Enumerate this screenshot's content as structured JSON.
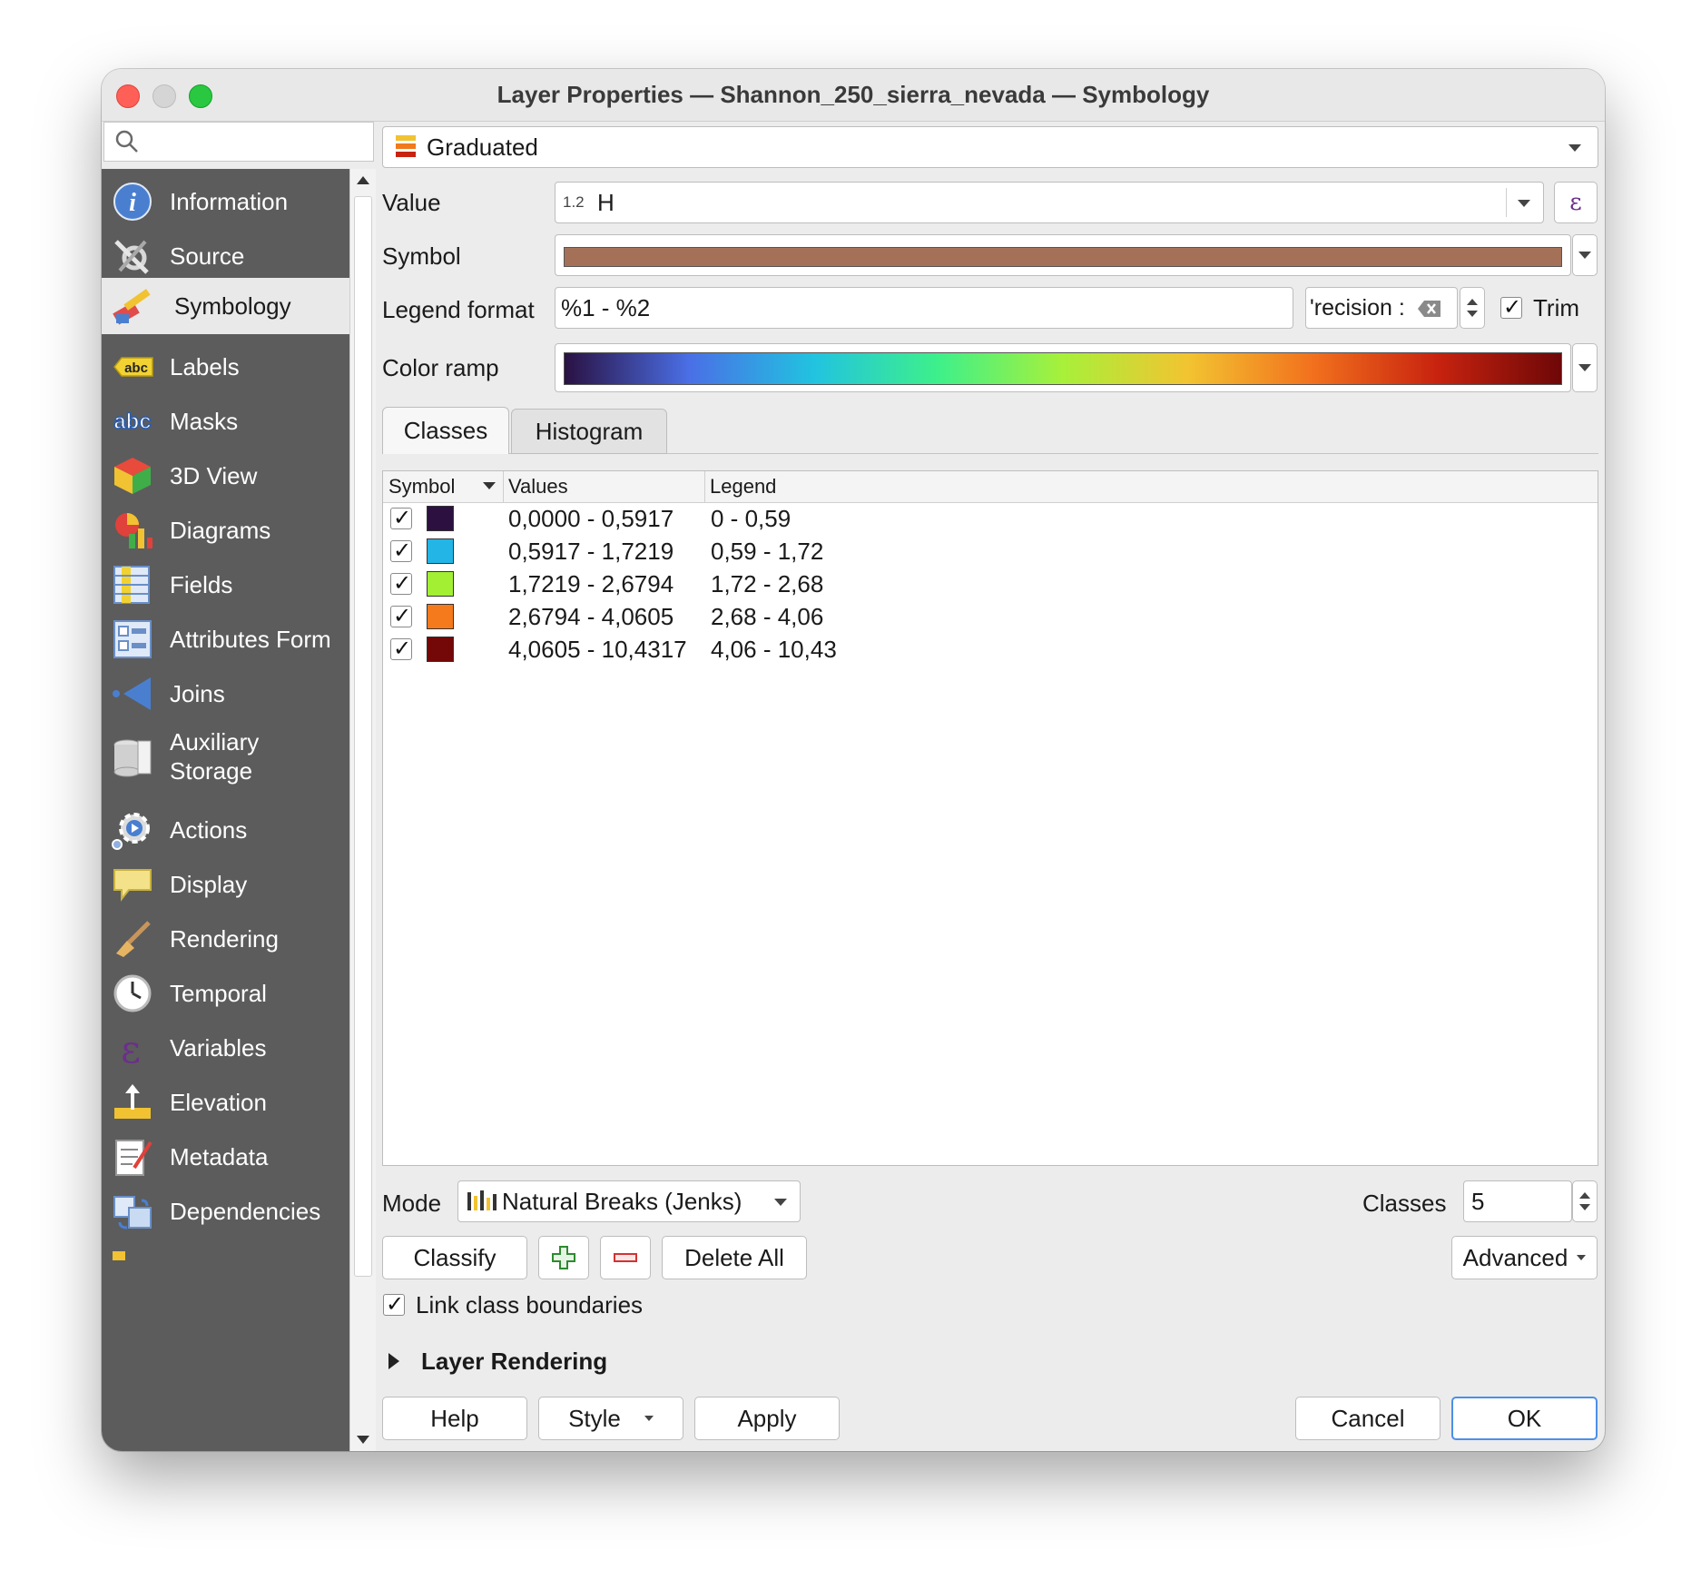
{
  "window": {
    "title": "Layer Properties — Shannon_250_sierra_nevada — Symbology"
  },
  "search": {
    "placeholder": ""
  },
  "sidebar": {
    "items": [
      {
        "label": "Information",
        "icon": "info-icon"
      },
      {
        "label": "Source",
        "icon": "source-wrench-icon"
      },
      {
        "label": "Symbology",
        "icon": "paintbrush-icon",
        "active": true
      },
      {
        "label": "Labels",
        "icon": "labels-abc-icon"
      },
      {
        "label": "Masks",
        "icon": "masks-abc-icon"
      },
      {
        "label": "3D View",
        "icon": "cube-icon"
      },
      {
        "label": "Diagrams",
        "icon": "diagrams-icon"
      },
      {
        "label": "Fields",
        "icon": "fields-icon"
      },
      {
        "label": "Attributes Form",
        "icon": "form-icon"
      },
      {
        "label": "Joins",
        "icon": "joins-icon"
      },
      {
        "label": "Auxiliary Storage",
        "icon": "database-icon"
      },
      {
        "label": "Actions",
        "icon": "actions-gear-icon"
      },
      {
        "label": "Display",
        "icon": "speech-bubble-icon"
      },
      {
        "label": "Rendering",
        "icon": "brush-icon"
      },
      {
        "label": "Temporal",
        "icon": "clock-icon"
      },
      {
        "label": "Variables",
        "icon": "epsilon-icon"
      },
      {
        "label": "Elevation",
        "icon": "elevation-icon"
      },
      {
        "label": "Metadata",
        "icon": "metadata-icon"
      },
      {
        "label": "Dependencies",
        "icon": "dependencies-icon"
      }
    ]
  },
  "renderer": {
    "selected": "Graduated"
  },
  "value": {
    "label": "Value",
    "type_badge": "1.2",
    "field": "H",
    "expression_glyph": "ε"
  },
  "symbol": {
    "label": "Symbol",
    "color": "#a47158"
  },
  "legend_format": {
    "label": "Legend format",
    "value": "%1 - %2",
    "precision_text": "'recision :",
    "trim_label": "Trim"
  },
  "color_ramp": {
    "label": "Color ramp",
    "stops": [
      "#2a1142",
      "#4a6fe6",
      "#21c3e0",
      "#3ef08a",
      "#a8f03a",
      "#f2c431",
      "#f2711d",
      "#c8230f",
      "#6e0707"
    ]
  },
  "tabs": [
    {
      "label": "Classes",
      "active": true
    },
    {
      "label": "Histogram",
      "active": false
    }
  ],
  "table": {
    "headers": {
      "symbol": "Symbol",
      "values": "Values",
      "legend": "Legend"
    },
    "rows": [
      {
        "checked": true,
        "color": "#2c1040",
        "values": "0,0000 - 0,5917",
        "legend": "0 - 0,59"
      },
      {
        "checked": true,
        "color": "#22b5e6",
        "values": "0,5917 - 1,7219",
        "legend": "0,59 - 1,72"
      },
      {
        "checked": true,
        "color": "#a3ef34",
        "values": "1,7219 - 2,6794",
        "legend": "1,72 - 2,68"
      },
      {
        "checked": true,
        "color": "#f57a1c",
        "values": "2,6794 - 4,0605",
        "legend": "2,68 - 4,06"
      },
      {
        "checked": true,
        "color": "#740707",
        "values": "4,0605 - 10,4317",
        "legend": "4,06 - 10,43"
      }
    ]
  },
  "mode": {
    "label": "Mode",
    "selected": "Natural Breaks (Jenks)"
  },
  "classes": {
    "label": "Classes",
    "value": "5"
  },
  "buttons": {
    "classify": "Classify",
    "delete_all": "Delete All",
    "advanced": "Advanced",
    "help": "Help",
    "style": "Style",
    "apply": "Apply",
    "cancel": "Cancel",
    "ok": "OK"
  },
  "link_class_boundaries": {
    "label": "Link class boundaries",
    "checked": true
  },
  "layer_rendering": {
    "label": "Layer Rendering"
  }
}
